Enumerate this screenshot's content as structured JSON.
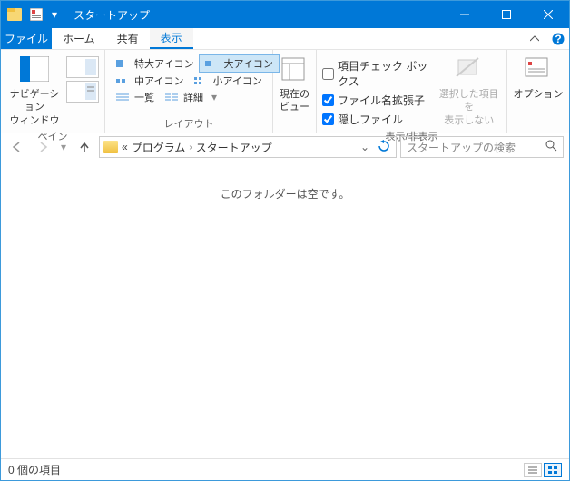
{
  "title": "スタートアップ",
  "tabs": {
    "file": "ファイル",
    "home": "ホーム",
    "share": "共有",
    "view": "表示"
  },
  "ribbon": {
    "panes": {
      "label": "ペイン",
      "nav": "ナビゲーション\nウィンドウ"
    },
    "layout": {
      "label": "レイアウト",
      "xl": "特大アイコン",
      "l": "大アイコン",
      "m": "中アイコン",
      "s": "小アイコン",
      "list": "一覧",
      "details": "詳細"
    },
    "current": {
      "label": "現在の\nビュー"
    },
    "showhide": {
      "label": "表示/非表示",
      "chk_boxes": "項目チェック ボックス",
      "ext": "ファイル名拡張子",
      "hidden": "隠しファイル",
      "hide_sel": "選択した項目を\n表示しない"
    },
    "options": "オプション"
  },
  "address": {
    "seg1": "プログラム",
    "seg2": "スタートアップ"
  },
  "search": {
    "placeholder": "スタートアップの検索"
  },
  "content": {
    "empty": "このフォルダーは空です。"
  },
  "status": {
    "count": "0 個の項目"
  }
}
